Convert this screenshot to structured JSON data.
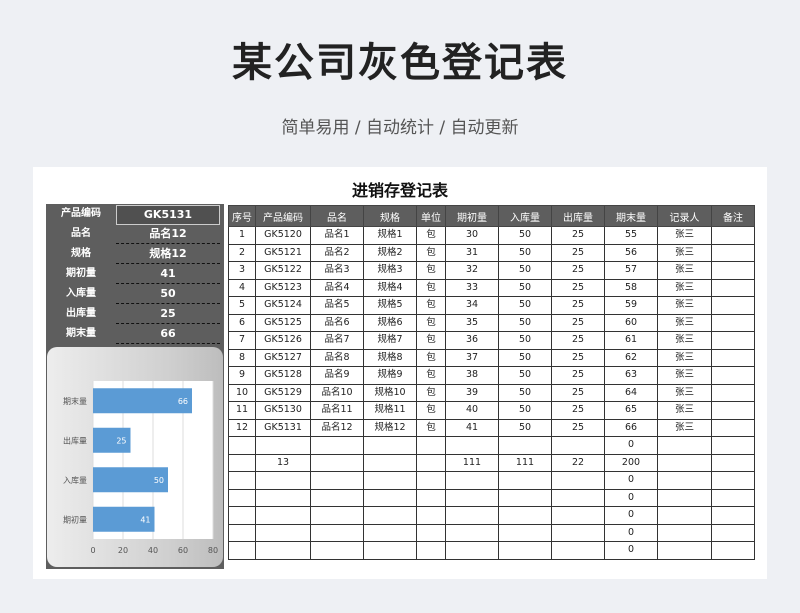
{
  "header": {
    "title": "某公司灰色登记表",
    "subtitle": "简单易用 / 自动统计 / 自动更新"
  },
  "sheet": {
    "title": "进销存登记表"
  },
  "summary": [
    {
      "label": "产品编码",
      "value": "GK5131"
    },
    {
      "label": "品名",
      "value": "品名12"
    },
    {
      "label": "规格",
      "value": "规格12"
    },
    {
      "label": "期初量",
      "value": "41"
    },
    {
      "label": "入库量",
      "value": "50"
    },
    {
      "label": "出库量",
      "value": "25"
    },
    {
      "label": "期末量",
      "value": "66"
    }
  ],
  "chart_data": {
    "type": "bar",
    "orientation": "horizontal",
    "categories": [
      "期末量",
      "出库量",
      "入库量",
      "期初量"
    ],
    "values": [
      66,
      25,
      50,
      41
    ],
    "xlim": [
      0,
      80
    ],
    "xticks": [
      "0",
      "20",
      "40",
      "60",
      "80"
    ],
    "grid": true,
    "bar_color": "#5b9bd5"
  },
  "table": {
    "columns": [
      "序号",
      "产品编码",
      "品名",
      "规格",
      "单位",
      "期初量",
      "入库量",
      "出库量",
      "期末量",
      "记录人",
      "备注"
    ],
    "rows": [
      [
        "1",
        "GK5120",
        "品名1",
        "规格1",
        "包",
        "30",
        "50",
        "25",
        "55",
        "张三",
        ""
      ],
      [
        "2",
        "GK5121",
        "品名2",
        "规格2",
        "包",
        "31",
        "50",
        "25",
        "56",
        "张三",
        ""
      ],
      [
        "3",
        "GK5122",
        "品名3",
        "规格3",
        "包",
        "32",
        "50",
        "25",
        "57",
        "张三",
        ""
      ],
      [
        "4",
        "GK5123",
        "品名4",
        "规格4",
        "包",
        "33",
        "50",
        "25",
        "58",
        "张三",
        ""
      ],
      [
        "5",
        "GK5124",
        "品名5",
        "规格5",
        "包",
        "34",
        "50",
        "25",
        "59",
        "张三",
        ""
      ],
      [
        "6",
        "GK5125",
        "品名6",
        "规格6",
        "包",
        "35",
        "50",
        "25",
        "60",
        "张三",
        ""
      ],
      [
        "7",
        "GK5126",
        "品名7",
        "规格7",
        "包",
        "36",
        "50",
        "25",
        "61",
        "张三",
        ""
      ],
      [
        "8",
        "GK5127",
        "品名8",
        "规格8",
        "包",
        "37",
        "50",
        "25",
        "62",
        "张三",
        ""
      ],
      [
        "9",
        "GK5128",
        "品名9",
        "规格9",
        "包",
        "38",
        "50",
        "25",
        "63",
        "张三",
        ""
      ],
      [
        "10",
        "GK5129",
        "品名10",
        "规格10",
        "包",
        "39",
        "50",
        "25",
        "64",
        "张三",
        ""
      ],
      [
        "11",
        "GK5130",
        "品名11",
        "规格11",
        "包",
        "40",
        "50",
        "25",
        "65",
        "张三",
        ""
      ],
      [
        "12",
        "GK5131",
        "品名12",
        "规格12",
        "包",
        "41",
        "50",
        "25",
        "66",
        "张三",
        ""
      ],
      [
        "",
        "",
        "",
        "",
        "",
        "",
        "",
        "",
        "0",
        "",
        ""
      ],
      [
        "",
        "13",
        "",
        "",
        "",
        "111",
        "111",
        "22",
        "200",
        "",
        ""
      ],
      [
        "",
        "",
        "",
        "",
        "",
        "",
        "",
        "",
        "0",
        "",
        ""
      ],
      [
        "",
        "",
        "",
        "",
        "",
        "",
        "",
        "",
        "0",
        "",
        ""
      ],
      [
        "",
        "",
        "",
        "",
        "",
        "",
        "",
        "",
        "0",
        "",
        ""
      ],
      [
        "",
        "",
        "",
        "",
        "",
        "",
        "",
        "",
        "0",
        "",
        ""
      ],
      [
        "",
        "",
        "",
        "",
        "",
        "",
        "",
        "",
        "0",
        "",
        ""
      ]
    ]
  }
}
